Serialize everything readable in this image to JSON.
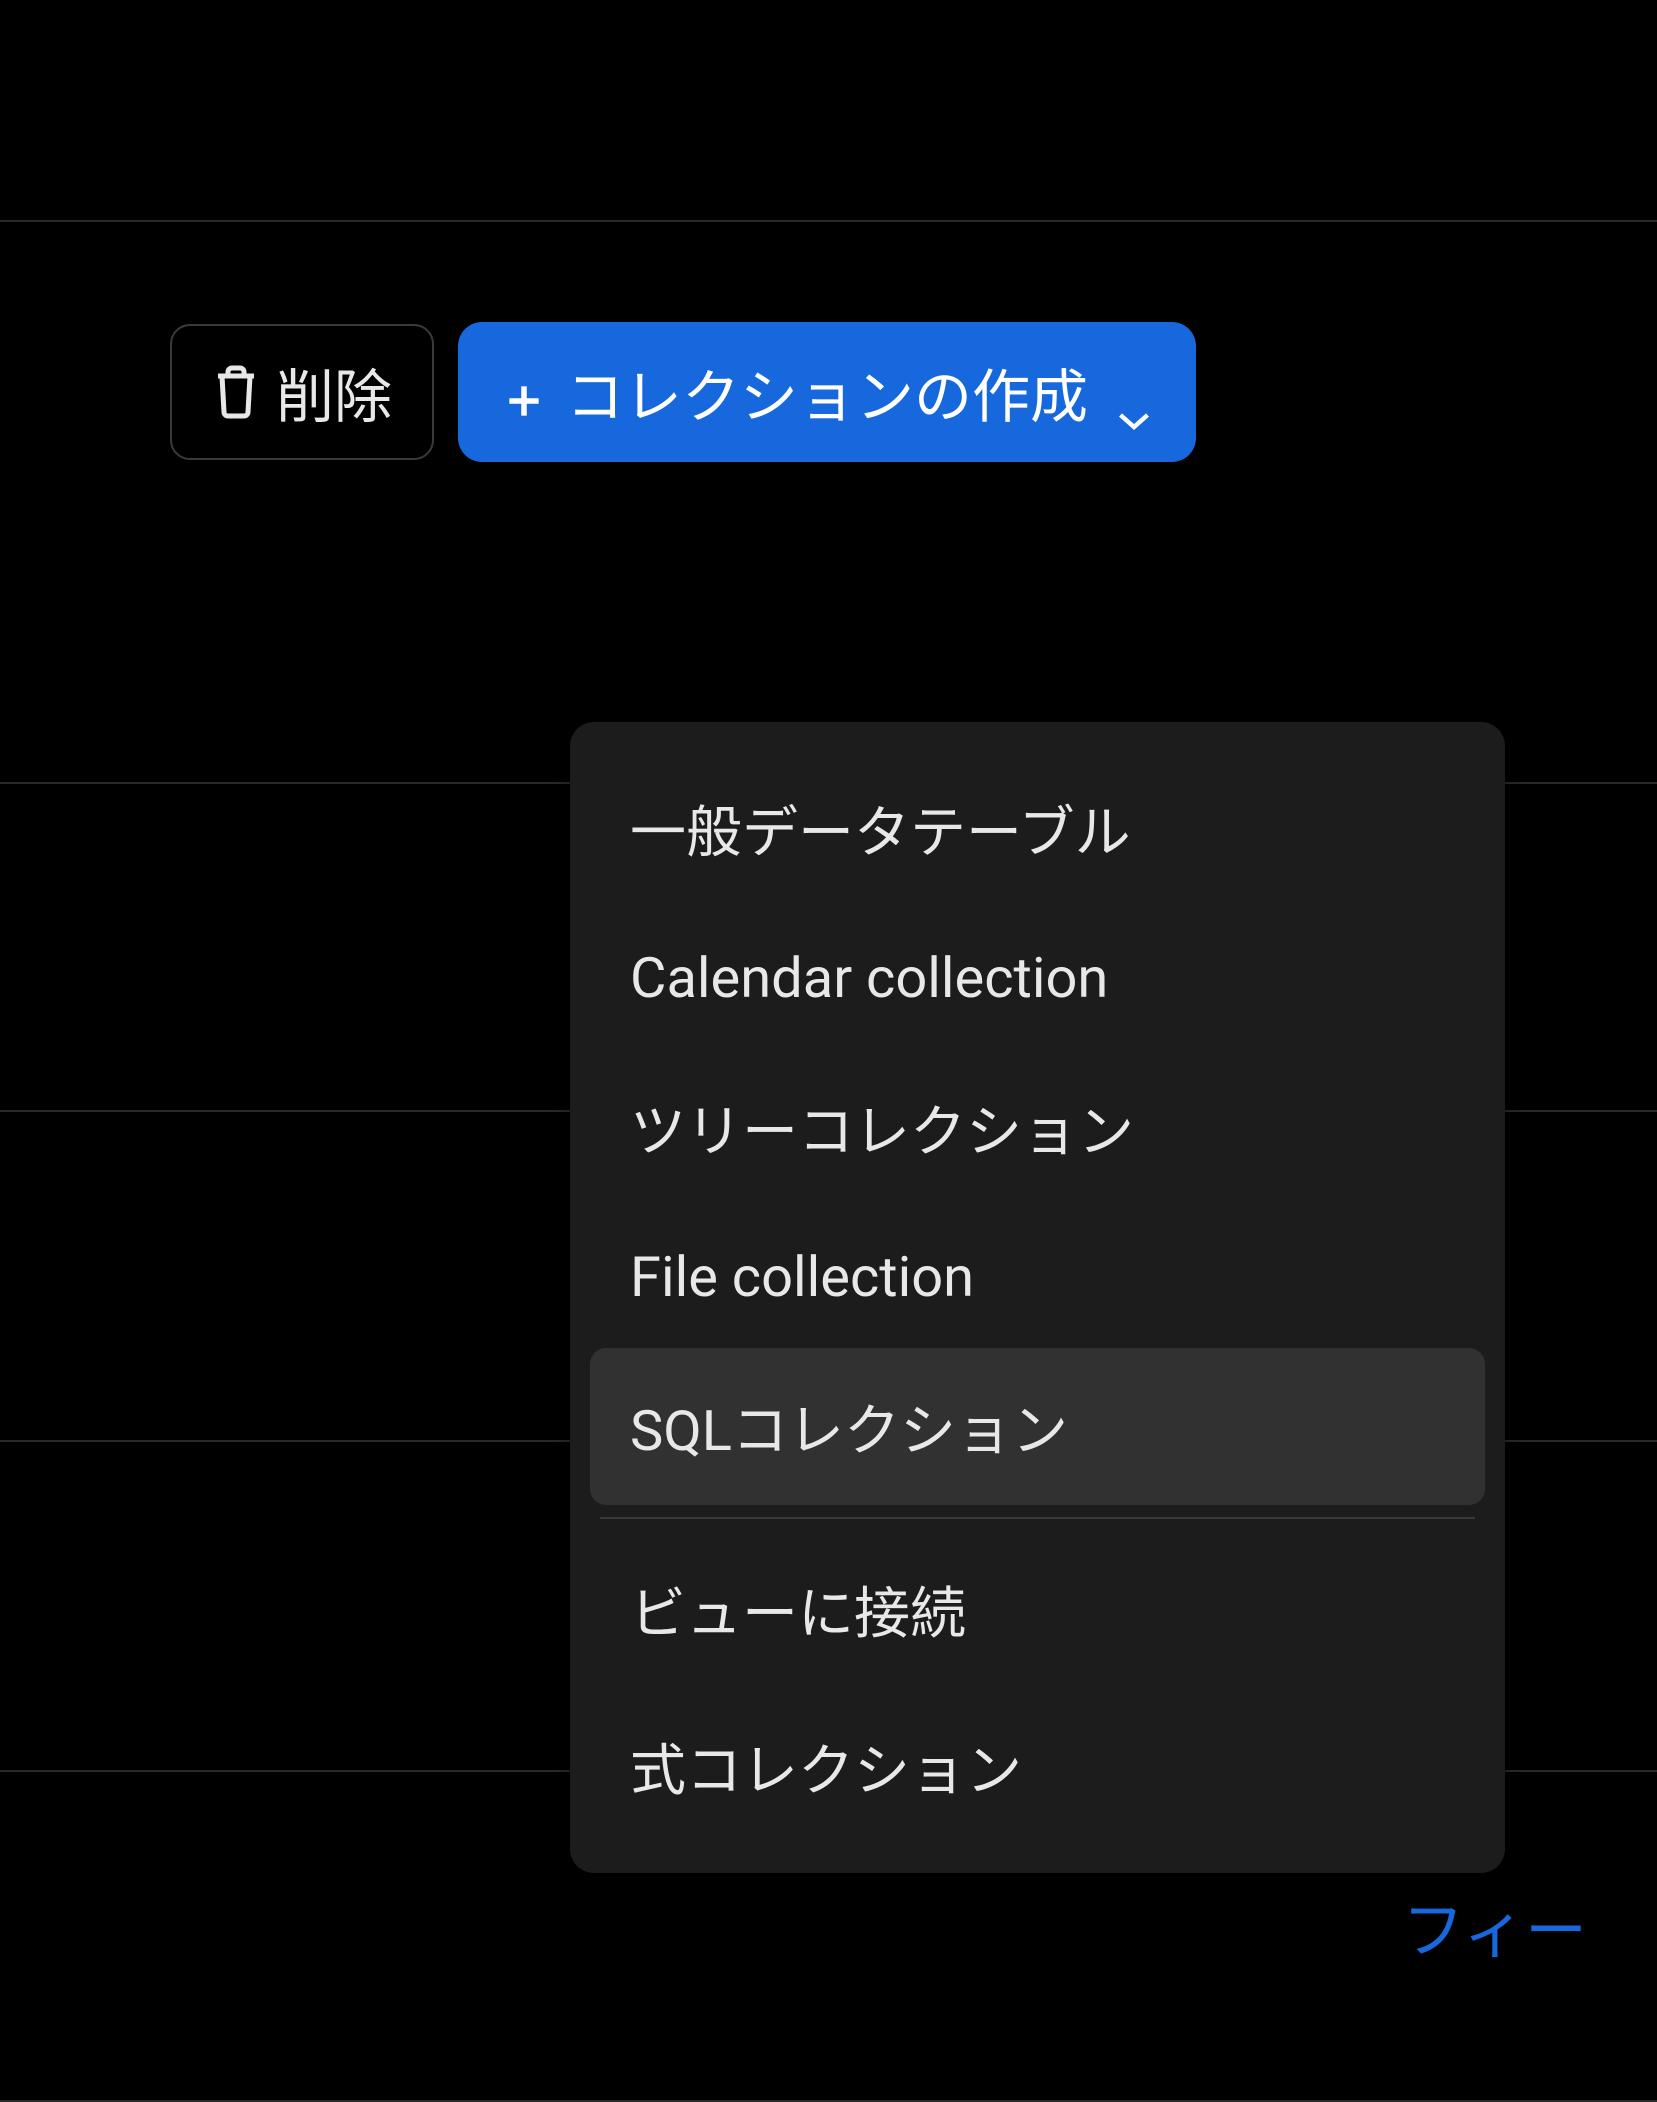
{
  "toolbar": {
    "delete_label": "削除",
    "create_label": "コレクションの作成"
  },
  "dropdown": {
    "items": [
      {
        "label": "一般データテーブル",
        "highlighted": false
      },
      {
        "label": "Calendar collection",
        "highlighted": false
      },
      {
        "label": "ツリーコレクション",
        "highlighted": false
      },
      {
        "label": "File collection",
        "highlighted": false
      },
      {
        "label": "SQLコレクション",
        "highlighted": true
      }
    ],
    "secondary_items": [
      {
        "label": "ビューに接続"
      },
      {
        "label": "式コレクション"
      }
    ]
  },
  "footer": {
    "link_text": "フィー"
  }
}
